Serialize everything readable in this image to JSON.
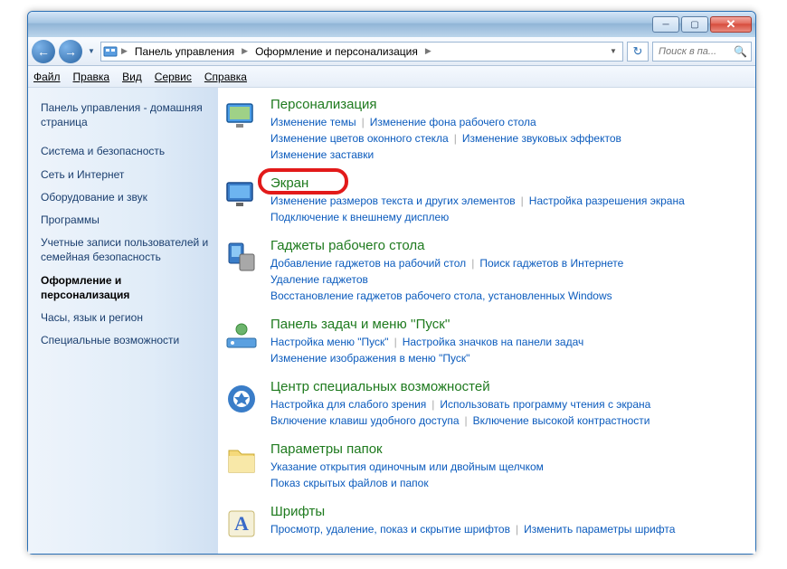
{
  "titlebar": {
    "minimize": "─",
    "maximize": "▢",
    "close": "✕"
  },
  "nav": {
    "back": "←",
    "forward": "→"
  },
  "address": {
    "root": "Панель управления",
    "current": "Оформление и персонализация"
  },
  "search": {
    "placeholder": "Поиск в па..."
  },
  "menu": {
    "file": "Файл",
    "edit": "Правка",
    "view": "Вид",
    "tools": "Сервис",
    "help": "Справка"
  },
  "sidebar": {
    "home": "Панель управления - домашняя страница",
    "items": [
      "Система и безопасность",
      "Сеть и Интернет",
      "Оборудование и звук",
      "Программы",
      "Учетные записи пользователей и семейная безопасность",
      "Оформление и персонализация",
      "Часы, язык и регион",
      "Специальные возможности"
    ],
    "current_index": 5
  },
  "categories": [
    {
      "title": "Персонализация",
      "links": [
        "Изменение темы",
        "Изменение фона рабочего стола",
        "Изменение цветов оконного стекла",
        "Изменение звуковых эффектов",
        "Изменение заставки"
      ],
      "breaks": [
        1,
        3
      ]
    },
    {
      "title": "Экран",
      "links": [
        "Изменение размеров текста и других элементов",
        "Настройка разрешения экрана",
        "Подключение к внешнему дисплею"
      ],
      "breaks": [
        1
      ]
    },
    {
      "title": "Гаджеты рабочего стола",
      "links": [
        "Добавление гаджетов на рабочий стол",
        "Поиск гаджетов в Интернете",
        "Удаление гаджетов",
        "Восстановление гаджетов рабочего стола, установленных Windows"
      ],
      "breaks": [
        1,
        2
      ]
    },
    {
      "title": "Панель задач и меню ''Пуск''",
      "links": [
        "Настройка меню \"Пуск\"",
        "Настройка значков на панели задач",
        "Изменение изображения в меню \"Пуск\""
      ],
      "breaks": [
        1
      ]
    },
    {
      "title": "Центр специальных возможностей",
      "links": [
        "Настройка для слабого зрения",
        "Использовать программу чтения с экрана",
        "Включение клавиш удобного доступа",
        "Включение высокой контрастности"
      ],
      "breaks": [
        1
      ]
    },
    {
      "title": "Параметры папок",
      "links": [
        "Указание открытия одиночным или двойным щелчком",
        "Показ скрытых файлов и папок"
      ],
      "breaks": [
        0
      ]
    },
    {
      "title": "Шрифты",
      "links": [
        "Просмотр, удаление, показ и скрытие шрифтов",
        "Изменить параметры шрифта"
      ],
      "breaks": []
    }
  ],
  "highlight": {
    "category_index": 1
  }
}
